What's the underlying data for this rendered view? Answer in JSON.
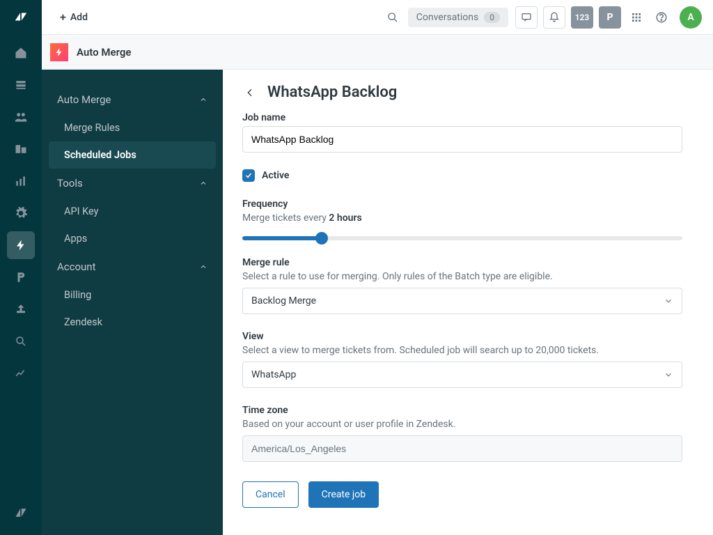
{
  "topbar": {
    "add_label": "Add",
    "conversations_label": "Conversations",
    "conversations_count": "0",
    "notif_count": "123",
    "p_badge": "P",
    "avatar_initial": "A"
  },
  "appheader": {
    "title": "Auto Merge"
  },
  "sidenav": {
    "groups": [
      {
        "label": "Auto Merge",
        "items": [
          "Merge Rules",
          "Scheduled Jobs"
        ],
        "active_item": "Scheduled Jobs"
      },
      {
        "label": "Tools",
        "items": [
          "API Key",
          "Apps"
        ]
      },
      {
        "label": "Account",
        "items": [
          "Billing",
          "Zendesk"
        ]
      }
    ]
  },
  "form": {
    "page_title": "WhatsApp Backlog",
    "job_name_label": "Job name",
    "job_name_value": "WhatsApp Backlog",
    "active_label": "Active",
    "active_checked": true,
    "frequency_label": "Frequency",
    "frequency_prefix": "Merge tickets every ",
    "frequency_value": "2 hours",
    "merge_rule_label": "Merge rule",
    "merge_rule_help": "Select a rule to use for merging. Only rules of the Batch type are eligible.",
    "merge_rule_value": "Backlog Merge",
    "view_label": "View",
    "view_help": "Select a view to merge tickets from. Scheduled job will search up to 20,000 tickets.",
    "view_value": "WhatsApp",
    "tz_label": "Time zone",
    "tz_help": "Based on your account or user profile in Zendesk.",
    "tz_value": "America/Los_Angeles",
    "cancel_label": "Cancel",
    "submit_label": "Create job"
  }
}
